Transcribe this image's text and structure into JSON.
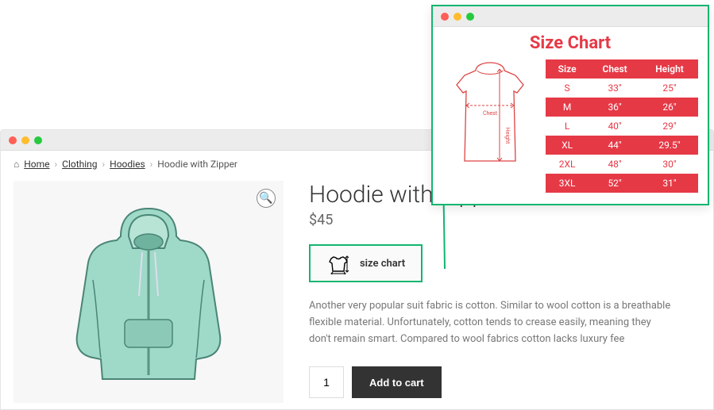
{
  "breadcrumbs": {
    "home": "Home",
    "clothing": "Clothing",
    "hoodies": "Hoodies",
    "current": "Hoodie with Zipper"
  },
  "product": {
    "title": "Hoodie with Zipper",
    "price": "$45",
    "size_chart_label": "size chart",
    "description": "Another very popular suit fabric is cotton. Similar to wool cotton is a breathable flexible material. Unfortunately, cotton tends to crease easily, meaning they don't remain smart. Compared to wool fabrics cotton lacks luxury fee",
    "qty": "1",
    "add_label": "Add to cart"
  },
  "size_chart": {
    "title": "Size Chart",
    "headers": {
      "size": "Size",
      "chest": "Chest",
      "height": "Height"
    },
    "rows": [
      {
        "size": "S",
        "chest": "33\"",
        "height": "25\""
      },
      {
        "size": "M",
        "chest": "36\"",
        "height": "26\""
      },
      {
        "size": "L",
        "chest": "40\"",
        "height": "29\""
      },
      {
        "size": "XL",
        "chest": "44\"",
        "height": "29.5\""
      },
      {
        "size": "2XL",
        "chest": "48\"",
        "height": "30\""
      },
      {
        "size": "3XL",
        "chest": "52\"",
        "height": "31\""
      }
    ],
    "diagram_labels": {
      "chest": "Chest",
      "height": "Height"
    }
  }
}
